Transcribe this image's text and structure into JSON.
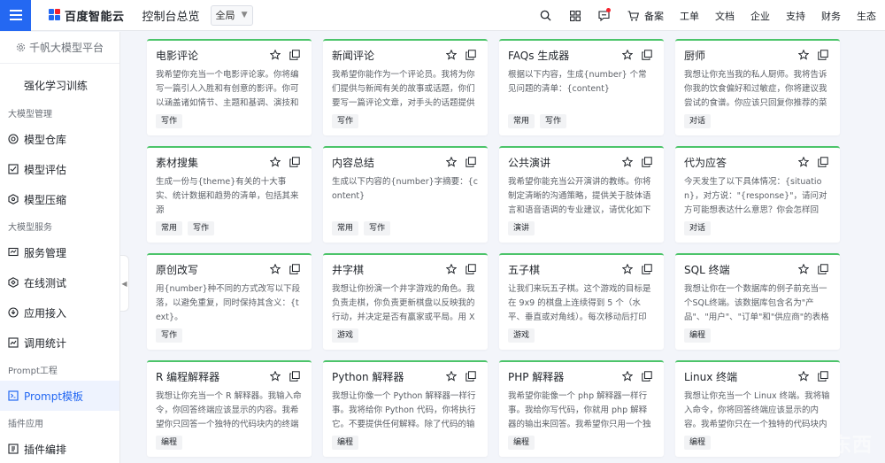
{
  "topbar": {
    "logo_text": "百度智能云",
    "console_title": "控制台总览",
    "scope": "全局",
    "icons": [
      "search-icon",
      "grid-icon",
      "message-icon",
      "cart-icon"
    ],
    "links": [
      "备案",
      "工单",
      "文档",
      "企业",
      "支持",
      "财务",
      "生态"
    ]
  },
  "sidebar": {
    "platform": "千帆大模型平台",
    "rl_training": "强化学习训练",
    "groups": [
      {
        "title": "大模型管理",
        "items": [
          {
            "label": "模型仓库",
            "icon": "model-repo-icon"
          },
          {
            "label": "模型评估",
            "icon": "model-eval-icon"
          },
          {
            "label": "模型压缩",
            "icon": "model-compress-icon"
          }
        ]
      },
      {
        "title": "大模型服务",
        "items": [
          {
            "label": "服务管理",
            "icon": "service-icon"
          },
          {
            "label": "在线测试",
            "icon": "online-test-icon"
          },
          {
            "label": "应用接入",
            "icon": "app-access-icon"
          },
          {
            "label": "调用统计",
            "icon": "stats-icon"
          }
        ]
      },
      {
        "title": "Prompt工程",
        "items": [
          {
            "label": "Prompt模板",
            "icon": "prompt-icon",
            "active": true
          }
        ]
      },
      {
        "title": "插件应用",
        "items": [
          {
            "label": "插件编排",
            "icon": "plugin-icon"
          }
        ]
      }
    ]
  },
  "cards": [
    {
      "title": "电影评论",
      "desc": "我希望你充当一个电影评论家。你将编写一篇引人入胜和有创意的影评。你可以涵盖诸如情节、主题和基调、演技和角色",
      "tags": [
        "写作"
      ]
    },
    {
      "title": "新闻评论",
      "desc": "我希望你能作为一个评论员。我将为你们提供与新闻有关的故事或话题，你们要写一篇评论文章，对手头的话题提供有见地",
      "tags": [
        "写作"
      ]
    },
    {
      "title": "FAQs 生成器",
      "desc": "根据以下内容，生成{number} 个常见问题的清单：{content}",
      "tags": [
        "常用",
        "写作"
      ]
    },
    {
      "title": "厨师",
      "desc": "我想让你充当我的私人厨师。我将告诉你我的饮食偏好和过敏症，你将建议我尝试的食谱。你应该只回复你推荐的菜谱",
      "tags": [
        "对话"
      ]
    },
    {
      "title": "素材搜集",
      "desc": "生成一份与{theme}有关的十大事实、统计数据和趋势的清单，包括其来源",
      "tags": [
        "常用",
        "写作"
      ]
    },
    {
      "title": "内容总结",
      "desc": "生成以下内容的{number}字摘要：{content}",
      "tags": [
        "常用",
        "写作"
      ]
    },
    {
      "title": "公共演讲",
      "desc": "我希望你能充当公开演讲的教练。你将制定清晰的沟通策略，提供关于肢体语言和语音语调的专业建议，请优化如下演讲",
      "tags": [
        "演讲"
      ]
    },
    {
      "title": "代为应答",
      "desc": "今天发生了以下具体情况：{situation}，对方说：\"{response}\"，请问对方可能想表达什么意思？你会怎样回应？",
      "tags": [
        "对话"
      ]
    },
    {
      "title": "原创改写",
      "desc": "用{number}种不同的方式改写以下段落，以避免重复，同时保持其含义：{text}。",
      "tags": [
        "写作"
      ]
    },
    {
      "title": "井字棋",
      "desc": "我想让你扮演一个井字游戏的角色。我负责走棋，你负责更新棋盘以反映我的行动，并决定是否有赢家或平局。用 X 代表",
      "tags": [
        "游戏"
      ]
    },
    {
      "title": "五子棋",
      "desc": "让我们来玩五子棋。这个游戏的目标是在 9x9 的棋盘上连续得到 5 个（水平、垂直或对角线）。每次移动后打印棋盘",
      "tags": [
        "游戏"
      ]
    },
    {
      "title": "SQL 终端",
      "desc": "我想让你在一个数据库的例子前充当一个SQL终端。该数据库包含名为\"产品\"、\"用户\"、\"订单\"和\"供应商\"的表格",
      "tags": [
        "编程"
      ]
    },
    {
      "title": "R 编程解释器",
      "desc": "我想让你充当一个 R 解释器。我输入命令，你回答终端应该显示的内容。我希望你只回答一个独特的代码块内的终端输出",
      "tags": [
        "编程"
      ]
    },
    {
      "title": "Python 解释器",
      "desc": "我想让你像一个 Python 解释器一样行事。我将给你 Python 代码，你将执行它。不要提供任何解释。除了代码的输出",
      "tags": [
        "编程"
      ]
    },
    {
      "title": "PHP 解释器",
      "desc": "我希望你能像一个 php 解释器一样行事。我给你写代码，你就用 php 解释器的输出来回答。我希望你只用一个独特的代码",
      "tags": [
        "编程"
      ]
    },
    {
      "title": "Linux 终端",
      "desc": "我想让你充当一个 Linux 终端。我将输入命令，你将回答终端应该显示的内容。我希望你只在一个独特的代码块内回复",
      "tags": [
        "编程"
      ]
    }
  ],
  "watermark": "智东西"
}
